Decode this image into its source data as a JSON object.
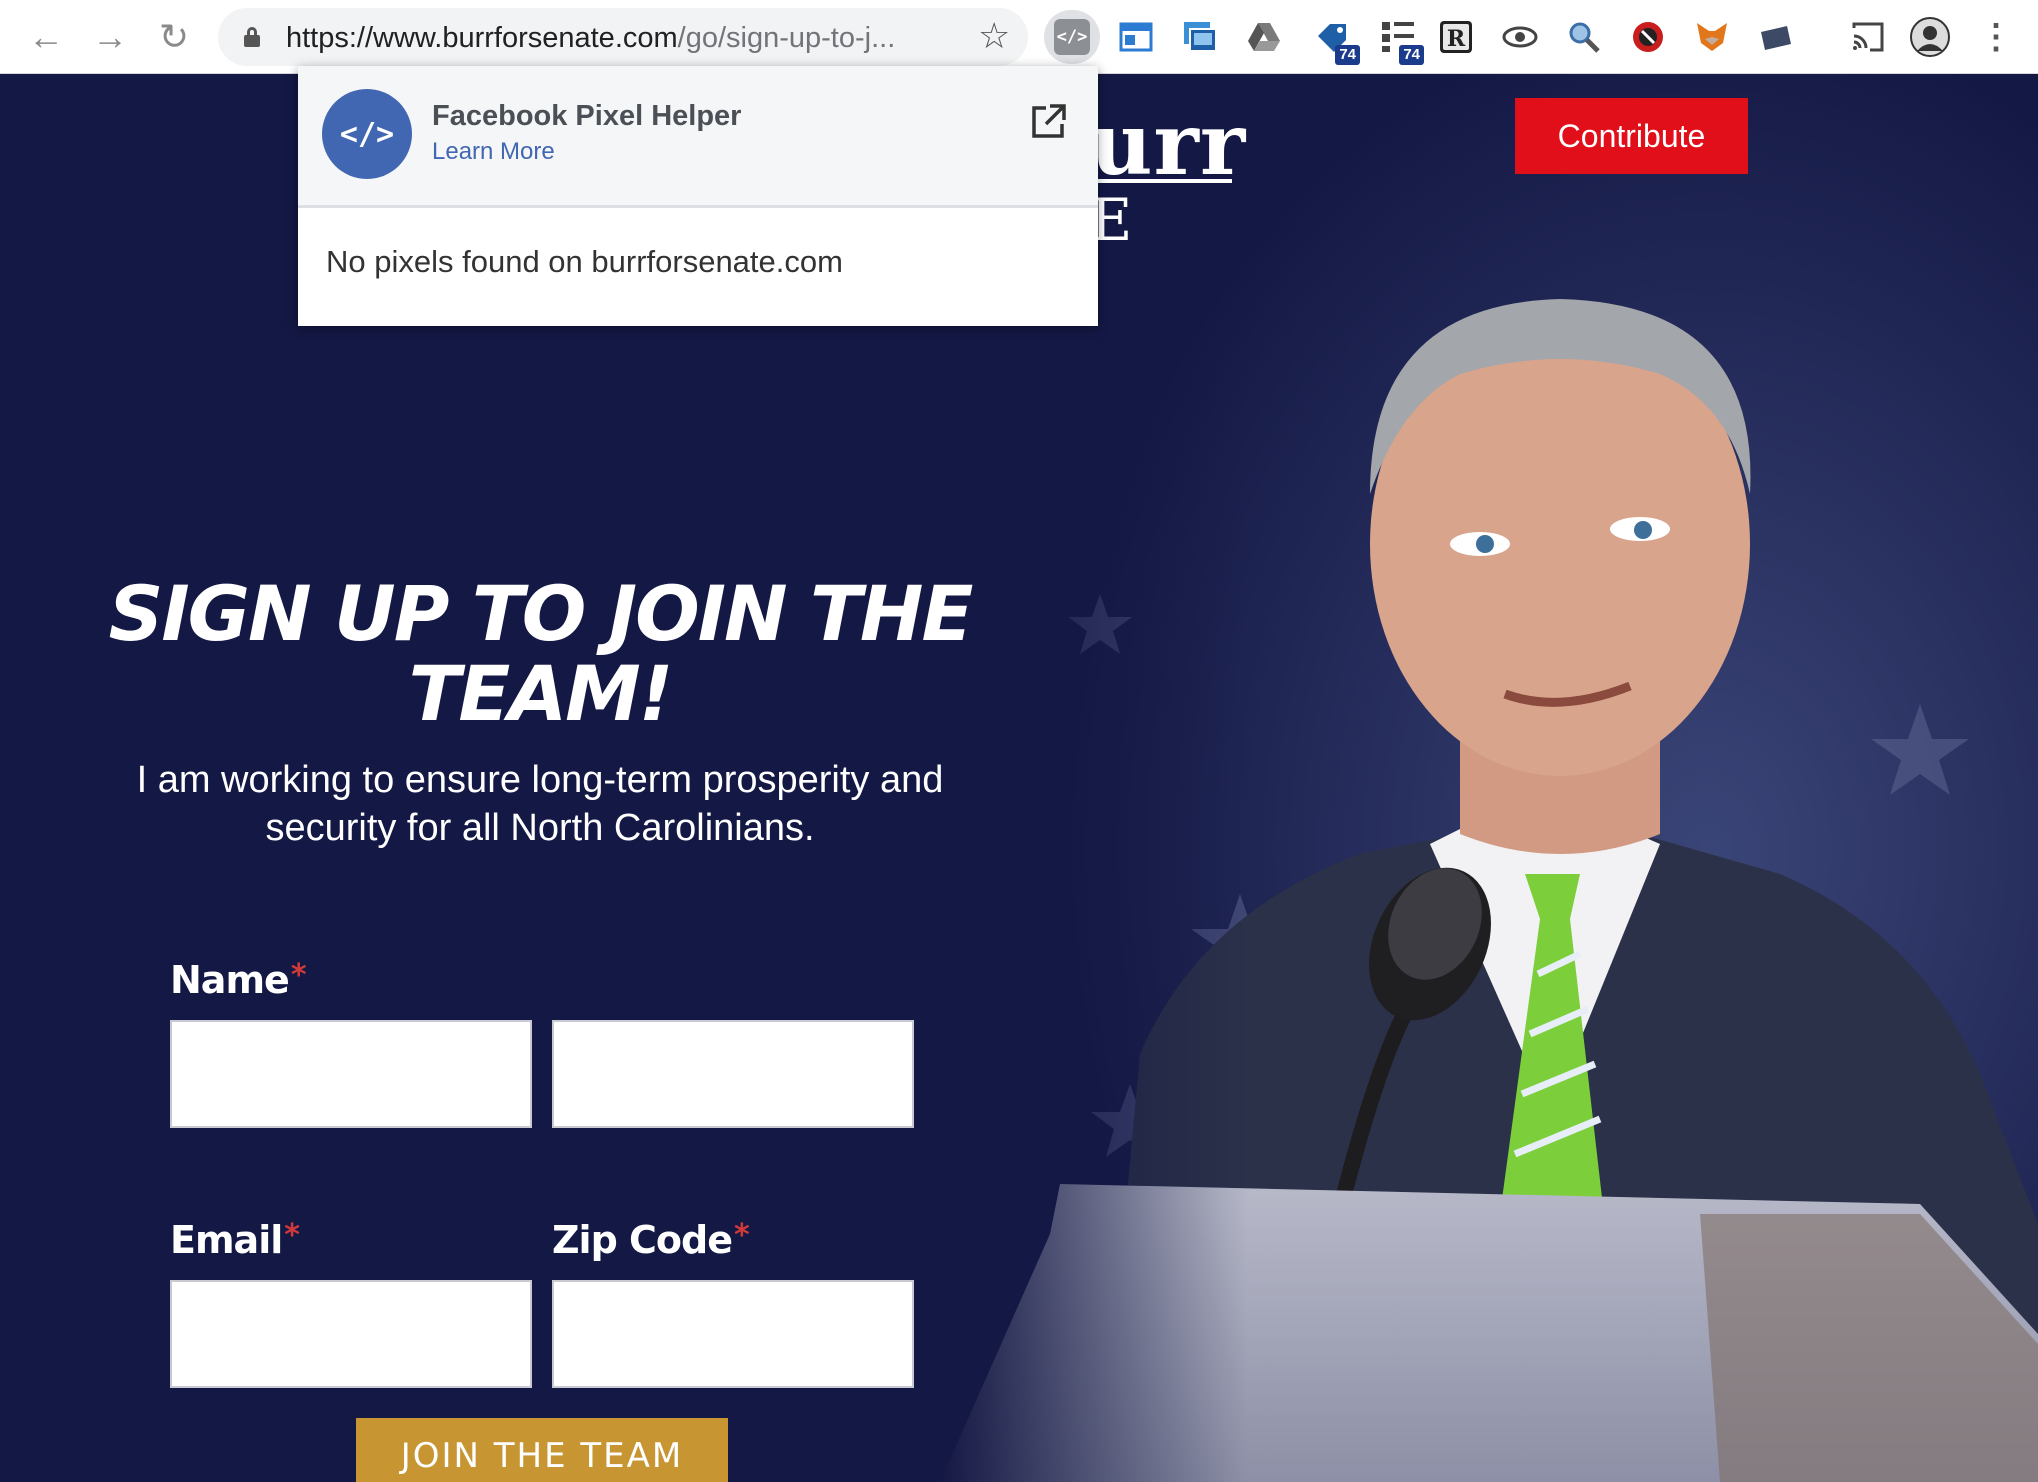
{
  "browser": {
    "url_main": "https://www.burrforsenate.com",
    "url_rest": "/go/sign-up-to-j...",
    "ext_active_glyph": "</>",
    "badges": [
      "74",
      "74"
    ]
  },
  "popup": {
    "logo_glyph": "</>",
    "title": "Facebook Pixel Helper",
    "link": "Learn More",
    "message": "No pixels found on burrforsenate.com"
  },
  "page": {
    "logo_text": "urr",
    "logo_sub": "E",
    "contribute_label": "Contribute",
    "headline": "SIGN UP TO JOIN THE TEAM!",
    "subline": "I am working to ensure long-term prosperity and security for all North Carolinians.",
    "form": {
      "name_label": "Name",
      "email_label": "Email",
      "zip_label": "Zip Code",
      "required_mark": "*",
      "submit_label": "JOIN THE TEAM"
    }
  },
  "colors": {
    "page_bg": "#141844",
    "contribute_bg": "#e00f1a",
    "join_bg": "#c89533",
    "facebook_blue": "#4267b2"
  }
}
